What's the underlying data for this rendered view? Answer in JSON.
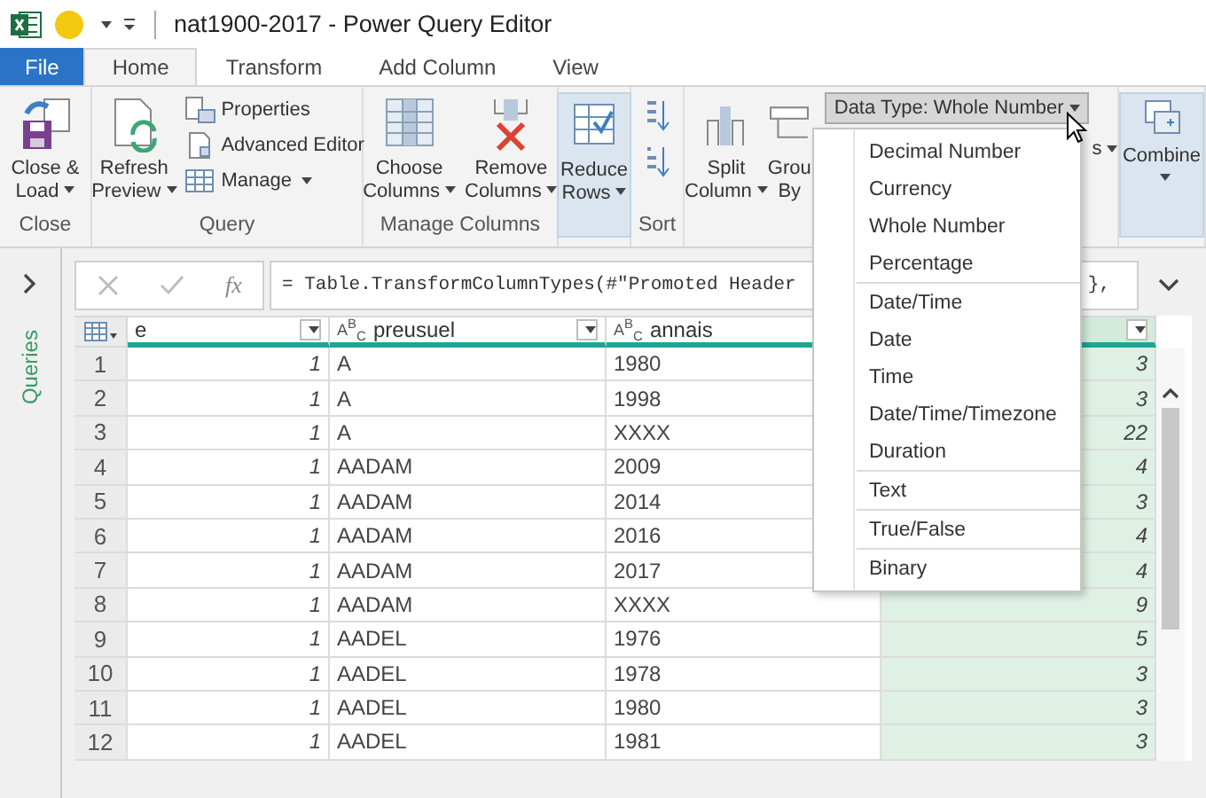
{
  "window": {
    "title": "nat1900-2017 - Power Query Editor"
  },
  "tabs": [
    {
      "label": "File",
      "kind": "file",
      "selected": false
    },
    {
      "label": "Home",
      "kind": "tab",
      "selected": true
    },
    {
      "label": "Transform",
      "kind": "tab",
      "selected": false
    },
    {
      "label": "Add Column",
      "kind": "tab",
      "selected": false
    },
    {
      "label": "View",
      "kind": "tab",
      "selected": false
    }
  ],
  "ribbon": {
    "groups": [
      {
        "kind": "buttons",
        "label": "Close",
        "buttons": [
          {
            "lines": [
              "Close &",
              "Load"
            ],
            "menu": true,
            "highlighted": false
          }
        ]
      },
      {
        "kind": "buttons",
        "label": "Query",
        "buttons": [
          {
            "lines": [
              "Refresh",
              "Preview"
            ],
            "menu": true,
            "highlighted": false
          }
        ],
        "small_buttons": [
          {
            "label": "Properties",
            "menu": false
          },
          {
            "label": "Advanced Editor",
            "menu": false
          },
          {
            "label": "Manage",
            "menu": true
          }
        ]
      },
      {
        "kind": "buttons",
        "label": "Manage Columns",
        "buttons": [
          {
            "lines": [
              "Choose",
              "Columns"
            ],
            "menu": true,
            "highlighted": false
          },
          {
            "lines": [
              "Remove",
              "Columns"
            ],
            "menu": true,
            "highlighted": false
          }
        ]
      },
      {
        "kind": "buttons",
        "buttons": [
          {
            "lines": [
              "Reduce",
              "Rows"
            ],
            "menu": true,
            "highlighted": true
          }
        ]
      },
      {
        "kind": "sort",
        "label": "Sort"
      },
      {
        "kind": "transform",
        "buttons": [
          {
            "lines": [
              "Split",
              "Column"
            ],
            "menu": true,
            "highlighted": false
          },
          {
            "lines": [
              "Grou",
              "By"
            ],
            "menu": false,
            "highlighted": false
          }
        ],
        "dropdown": {
          "label": "Data Type: Whole Number",
          "expanded": true
        },
        "partial": {
          "label": "s",
          "menu": true
        }
      },
      {
        "kind": "buttons",
        "buttons": [
          {
            "lines": [
              "Combine"
            ],
            "menu": true,
            "highlighted": true
          }
        ]
      }
    ]
  },
  "data_type_menu": {
    "sections": [
      [
        {
          "label": "Decimal Number",
          "selected": false
        },
        {
          "label": "Currency",
          "selected": false
        },
        {
          "label": "Whole Number",
          "selected": false
        },
        {
          "label": "Percentage",
          "selected": false
        }
      ],
      [
        {
          "label": "Date/Time",
          "selected": false
        },
        {
          "label": "Date",
          "selected": false
        },
        {
          "label": "Time",
          "selected": false
        },
        {
          "label": "Date/Time/Timezone",
          "selected": false
        },
        {
          "label": "Duration",
          "selected": false
        }
      ],
      [
        {
          "label": "Text",
          "selected": false
        }
      ],
      [
        {
          "label": "True/False",
          "selected": false
        }
      ],
      [
        {
          "label": "Binary",
          "selected": false
        }
      ]
    ]
  },
  "sidebar": {
    "label": "Queries",
    "expanded": false
  },
  "formula_bar": {
    "function_label": "fx",
    "formula": "= Table.TransformColumnTypes(#\"Promoted Header",
    "formula_tail": "},"
  },
  "table": {
    "columns": [
      {
        "name": "e",
        "kind": "number",
        "selected": false,
        "filter_button": true
      },
      {
        "name": "preusuel",
        "type": "A$^{B}$$_{C}$",
        "kind": "text",
        "selected": false,
        "filter_button": true
      },
      {
        "name": "annais",
        "type": "A$^{B}$$_{C}$",
        "kind": "text",
        "selected": false,
        "filter_button": false
      },
      {
        "kind": "number",
        "selected": true,
        "filter_button": true
      }
    ],
    "rows": [
      {
        "number": "1",
        "cells": [
          "1",
          "A",
          "1980",
          "3"
        ]
      },
      {
        "number": "2",
        "cells": [
          "1",
          "A",
          "1998",
          "3"
        ]
      },
      {
        "number": "3",
        "cells": [
          "1",
          "A",
          "XXXX",
          "22"
        ]
      },
      {
        "number": "4",
        "cells": [
          "1",
          "AADAM",
          "2009",
          "4"
        ]
      },
      {
        "number": "5",
        "cells": [
          "1",
          "AADAM",
          "2014",
          "3"
        ]
      },
      {
        "number": "6",
        "cells": [
          "1",
          "AADAM",
          "2016",
          "4"
        ]
      },
      {
        "number": "7",
        "cells": [
          "1",
          "AADAM",
          "2017",
          "4"
        ]
      },
      {
        "number": "8",
        "cells": [
          "1",
          "AADAM",
          "XXXX",
          "9"
        ]
      },
      {
        "number": "9",
        "cells": [
          "1",
          "AADEL",
          "1976",
          "5"
        ]
      },
      {
        "number": "10",
        "cells": [
          "1",
          "AADEL",
          "1978",
          "3"
        ]
      },
      {
        "number": "11",
        "cells": [
          "1",
          "AADEL",
          "1980",
          "3"
        ]
      },
      {
        "number": "12",
        "cells": [
          "1",
          "AADEL",
          "1981",
          "3"
        ]
      }
    ]
  }
}
